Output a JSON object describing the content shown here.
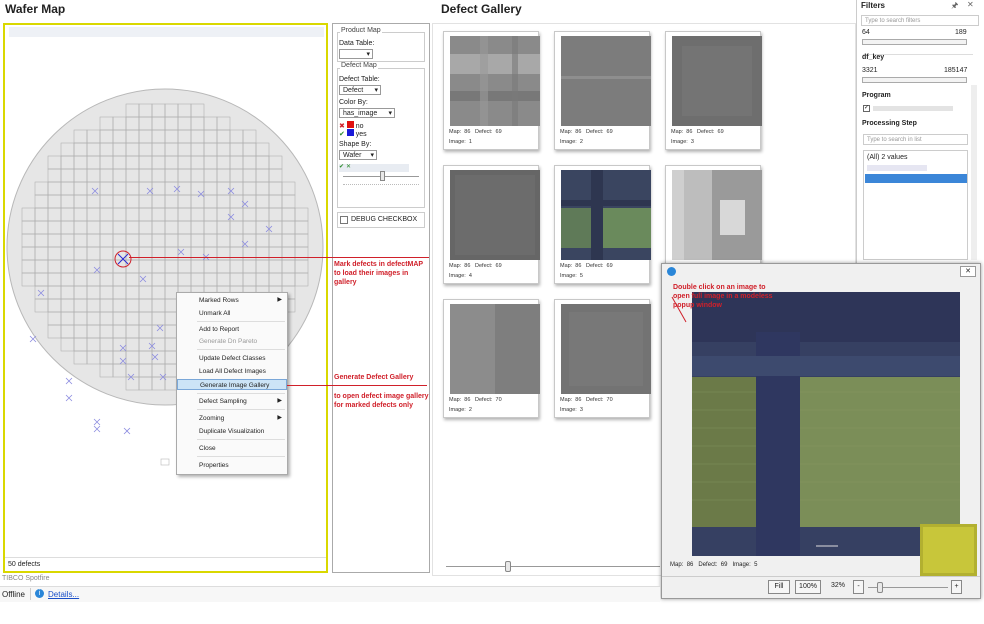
{
  "wafer_map": {
    "title": "Wafer Map",
    "subtitle": "",
    "footer": "50 defects"
  },
  "product_map": {
    "group1_title": "Product Map",
    "data_table_label": "Data Table:",
    "data_table_value": "",
    "group2_title": "Defect Map",
    "defect_table_label": "Defect Table:",
    "defect_table_value": "Defect",
    "color_by_label": "Color By:",
    "color_by_value": "has_image",
    "legend": [
      {
        "label": "no",
        "color": "#e01010"
      },
      {
        "label": "yes",
        "color": "#1a1ad8"
      }
    ],
    "shape_by_label": "Shape By:",
    "shape_by_value": "Wafer",
    "debug_checkbox": "DEBUG CHECKBOX"
  },
  "context_menu": {
    "items": [
      {
        "label": "Marked Rows",
        "submenu": true
      },
      {
        "label": "Unmark All"
      },
      {
        "label": "Add to Report"
      },
      {
        "label": "Generate Dn Pareto",
        "disabled": true
      },
      {
        "label": "Update Defect Classes"
      },
      {
        "label": "Load All Defect Images"
      },
      {
        "label": "Generate Image Gallery",
        "selected": true
      },
      {
        "label": "Defect Sampling",
        "submenu": true
      },
      {
        "label": "Zooming",
        "submenu": true
      },
      {
        "label": "Duplicate Visualization"
      },
      {
        "label": "Close"
      },
      {
        "label": "Properties"
      }
    ]
  },
  "gallery": {
    "title": "Defect Gallery",
    "tiles": [
      {
        "map_label": "Map:",
        "map": "86",
        "defect_label": "Defect:",
        "defect": "69",
        "image_label": "Image:",
        "image": "1"
      },
      {
        "map_label": "Map:",
        "map": "86",
        "defect_label": "Defect:",
        "defect": "69",
        "image_label": "Image:",
        "image": "2"
      },
      {
        "map_label": "Map:",
        "map": "86",
        "defect_label": "Defect:",
        "defect": "69",
        "image_label": "Image:",
        "image": "3"
      },
      {
        "map_label": "Map:",
        "map": "86",
        "defect_label": "Defect:",
        "defect": "69",
        "image_label": "Image:",
        "image": "4"
      },
      {
        "map_label": "Map:",
        "map": "86",
        "defect_label": "Defect:",
        "defect": "69",
        "image_label": "Image:",
        "image": "5"
      },
      {
        "map_label": "Map:",
        "map": "86",
        "defect_label": "Defect:",
        "defect": "70",
        "image_label": "Image:",
        "image": "2"
      },
      {
        "map_label": "Map:",
        "map": "86",
        "defect_label": "Defect:",
        "defect": "70",
        "image_label": "Image:",
        "image": "3"
      }
    ]
  },
  "filters": {
    "title": "Filters",
    "search_placeholder": "Type to search filters",
    "range1_min": "64",
    "range1_max": "189",
    "df_key_label": "df_key",
    "df_key_min": "3321",
    "df_key_max": "185147",
    "program_label": "Program",
    "processing_step_label": "Processing Step",
    "step_search_placeholder": "Type to search in list",
    "all_values": "(All) 2 values"
  },
  "popup": {
    "info": {
      "map_label": "Map:",
      "map": "86",
      "defect_label": "Defect:",
      "defect": "69",
      "image_label": "Image:",
      "image": "5"
    },
    "fill_button": "Fill",
    "zoom100_button": "100%",
    "zoom_value": "32%",
    "minus_button": "-",
    "plus_button": "+",
    "close_glyph": "✕"
  },
  "annotations": {
    "mark": "Mark defects in defectMAP to load their images in gallery",
    "generate": "Generate Defect Gallery",
    "open": "to open defect image gallery for marked defects only",
    "double_click": "Double click on an image to open full image in a modeless popup window"
  },
  "status": {
    "brand": "TIBCO Spotfire",
    "offline": "Offline",
    "details": "Details..."
  }
}
